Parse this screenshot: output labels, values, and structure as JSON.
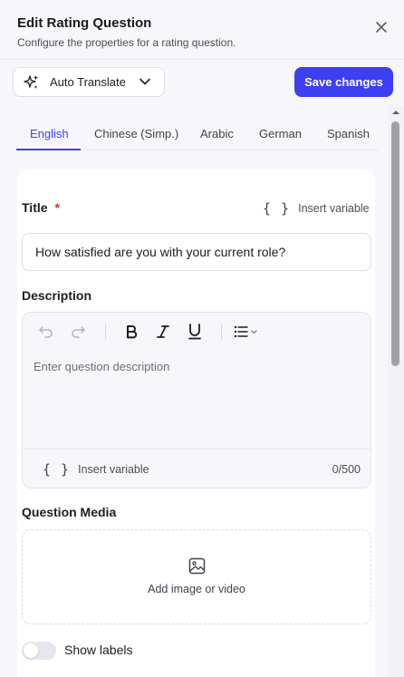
{
  "header": {
    "title": "Edit Rating Question",
    "subtitle": "Configure the properties for a rating question.",
    "close_icon": "close-icon"
  },
  "toolbar": {
    "auto_translate_label": "Auto Translate",
    "auto_translate_icon": "sparkles-icon",
    "save_label": "Save changes"
  },
  "tabs": [
    {
      "label": "English",
      "active": true
    },
    {
      "label": "Chinese (Simp.)",
      "active": false
    },
    {
      "label": "Arabic",
      "active": false
    },
    {
      "label": "German",
      "active": false
    },
    {
      "label": "Spanish",
      "active": false
    }
  ],
  "title_field": {
    "label": "Title",
    "required_mark": "*",
    "insert_variable_label": "Insert variable",
    "value": "How satisfied are you with your current role?"
  },
  "description_field": {
    "label": "Description",
    "placeholder": "Enter question description",
    "insert_variable_label": "Insert variable",
    "counter": "0/500",
    "tools": [
      "undo-icon",
      "redo-icon",
      "bold-icon",
      "italic-icon",
      "underline-icon",
      "list-icon"
    ]
  },
  "media": {
    "label": "Question Media",
    "add_label": "Add image or video",
    "icon": "image-icon"
  },
  "show_labels": {
    "label": "Show labels",
    "enabled": false
  },
  "colors": {
    "accent": "#3d3ff2",
    "required": "#d92d20",
    "panel_bg": "#f7f7fb"
  }
}
